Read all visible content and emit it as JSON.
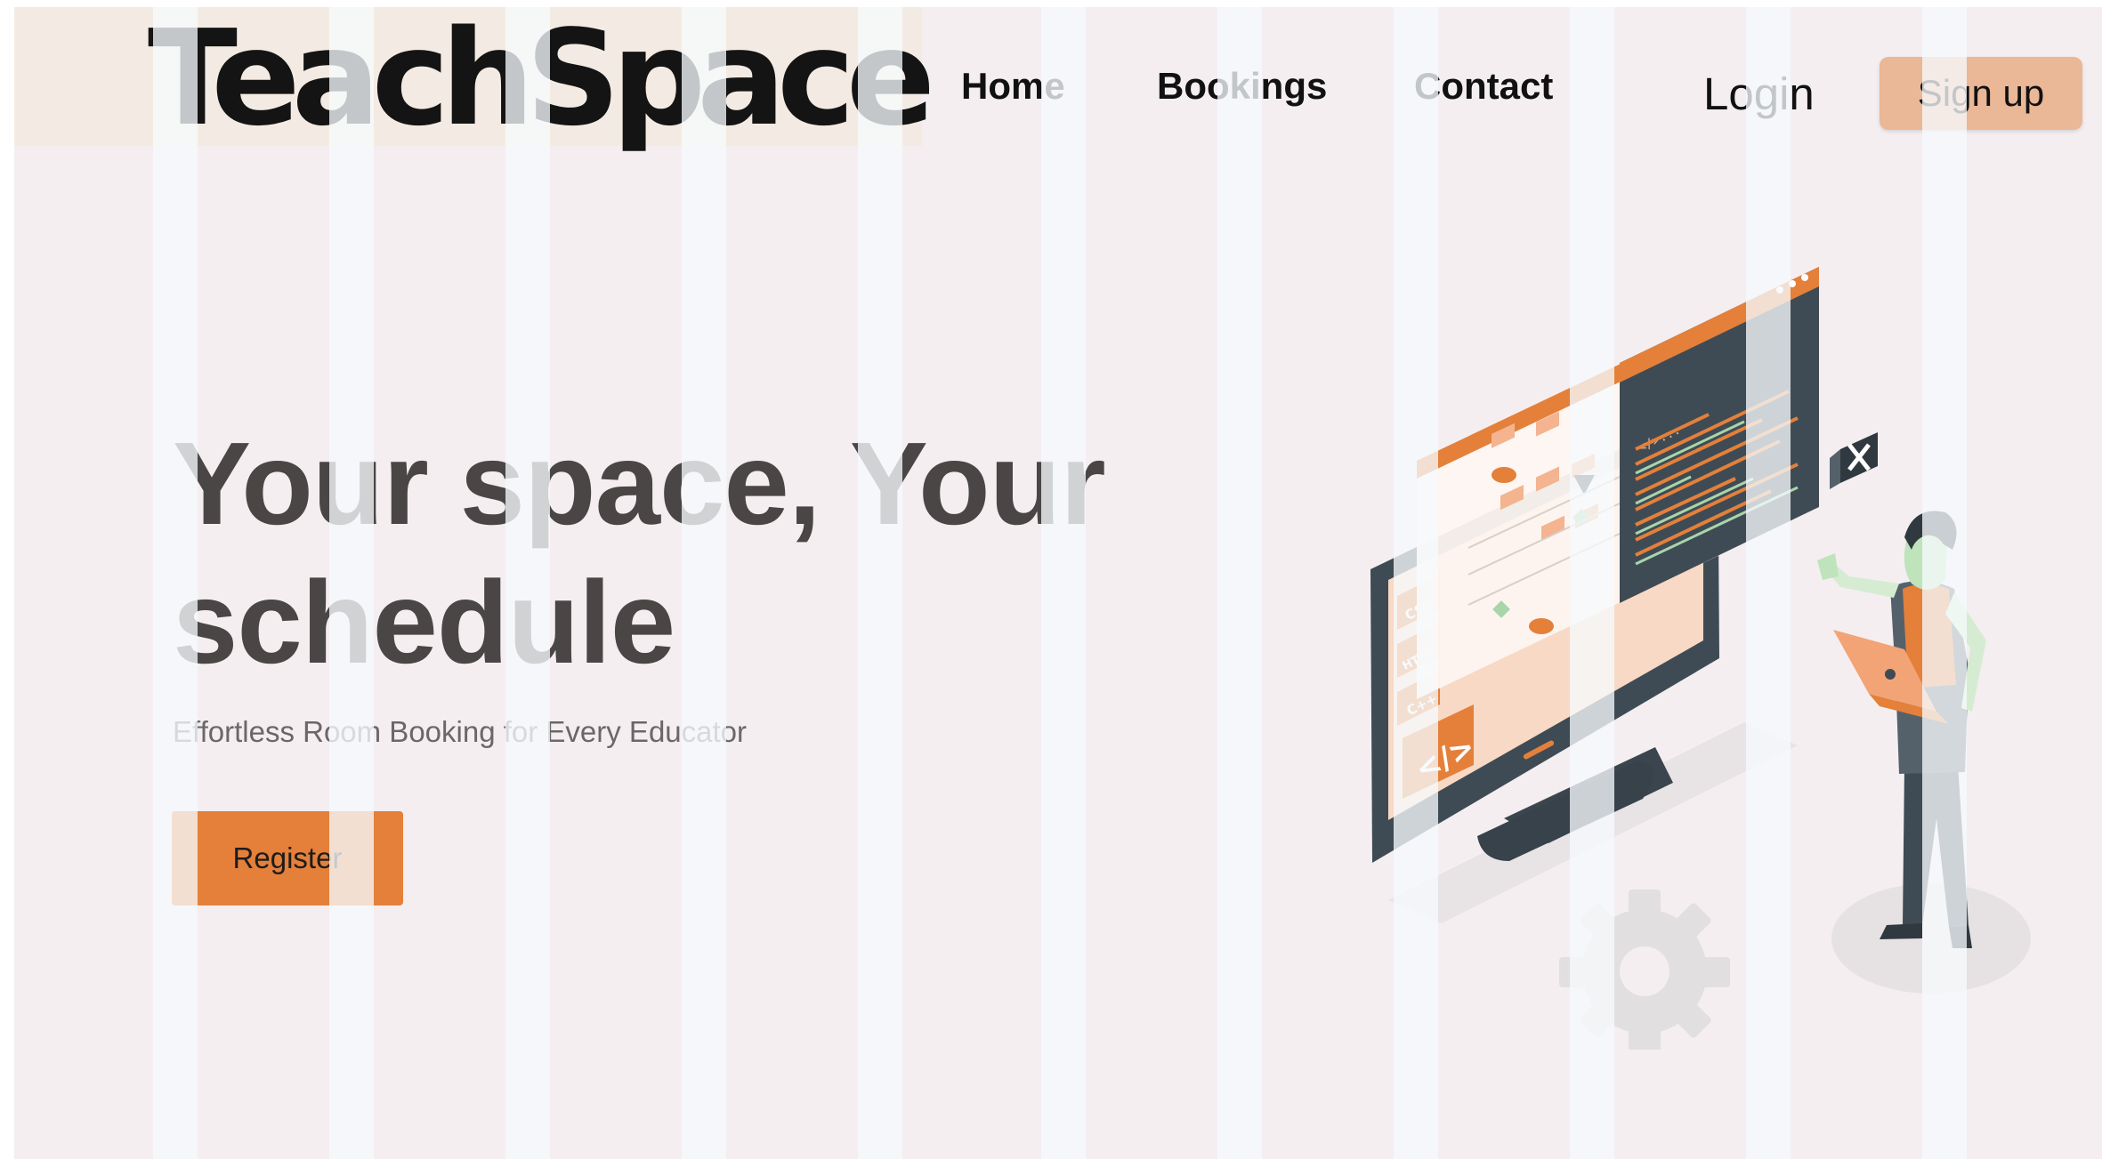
{
  "header": {
    "logo_text": "TeachSpace",
    "nav": {
      "home": "Home",
      "bookings": "Bookings",
      "contact": "Contact"
    },
    "login_label": "Login",
    "signup_label": "Sign up"
  },
  "hero": {
    "title": "Your space, Your schedule",
    "subtitle": "Effortless Room Booking for Every Educator",
    "register_label": "Register"
  },
  "illustration": {
    "badges": [
      "CSS",
      "HTML",
      "C++"
    ],
    "code_symbol": "</>",
    "code_header": "</>..."
  },
  "colors": {
    "accent": "#e4803a",
    "signup_bg": "#eab797",
    "page_bg": "#f4eef0",
    "logo_box_bg": "#f3ebe3",
    "heading": "#4a4646",
    "dark_slate": "#3f4b54"
  }
}
